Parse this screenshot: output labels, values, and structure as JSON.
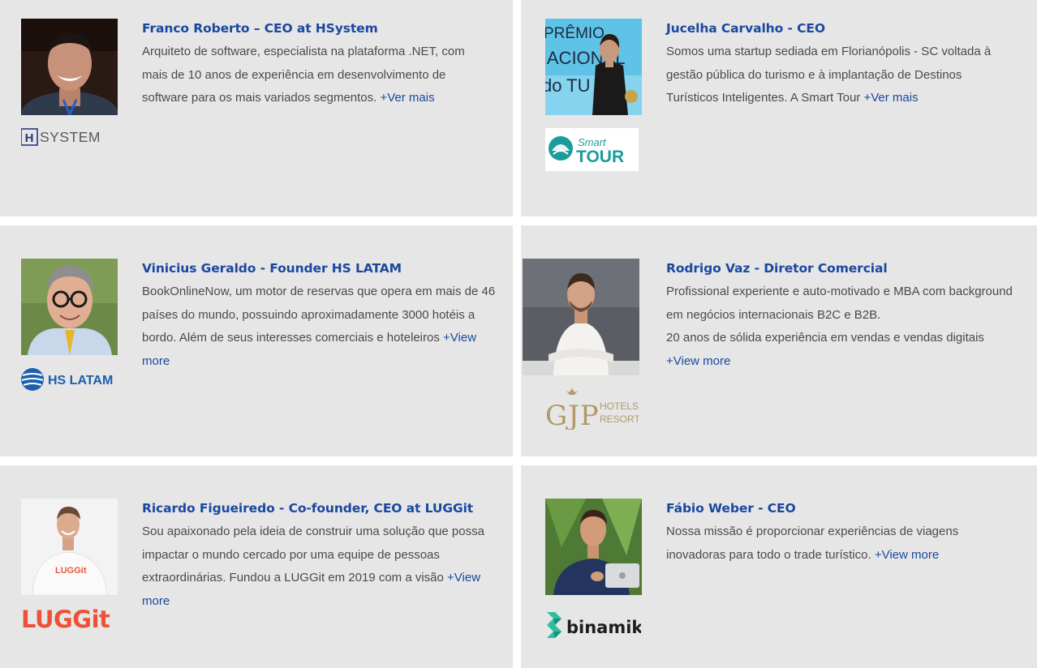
{
  "speakers": [
    {
      "name": "Franco Roberto – CEO at HSystem",
      "bio_lines": [
        "Arquiteto de software, especialista na plataforma .NET, com",
        "mais de 10 anos de experiência em desenvolvimento de",
        "software para os mais variados segmentos."
      ],
      "more_label": "+Ver mais",
      "logo_text": "SYSTEM",
      "logo_mark": "H"
    },
    {
      "name": "Jucelha Carvalho - CEO",
      "bio_lines": [
        "Somos uma startup sediada em Florianópolis - SC voltada à",
        "gestão pública do turismo e à implantação de Destinos",
        "Turísticos Inteligentes. A Smart Tour"
      ],
      "more_label": "+Ver mais",
      "photo_text": [
        "PRÊMIO",
        "NACIONAL",
        "do TU"
      ],
      "logo_text_top": "Smart",
      "logo_text_bottom": "TOUR"
    },
    {
      "name": "Vinicius Geraldo - Founder HS LATAM",
      "bio_lines": [
        "BookOnlineNow, um motor de reservas que opera em mais de 46",
        "países do mundo, possuindo aproximadamente 3000 hotéis a",
        "bordo. Além de seus interesses comerciais e hoteleiros",
        "more"
      ],
      "more_label": "+View",
      "logo_text": "HS LATAM"
    },
    {
      "name": "Rodrigo Vaz - Diretor Comercial",
      "bio_lines": [
        "Profissional experiente e auto-motivado e MBA com background",
        "em negócios internacionais B2C e B2B.",
        "20 anos de sólida experiência em vendas e vendas digitais"
      ],
      "more_label": "+View more",
      "logo_text": "GJP",
      "logo_sub": [
        "HOTELS &",
        "RESORTS"
      ]
    },
    {
      "name": "Ricardo Figueiredo - Co-founder, CEO at LUGGit",
      "bio_lines": [
        "Sou apaixonado pela ideia de construir uma solução que possa",
        "impactar o mundo cercado por uma equipe de pessoas",
        "extraordinárias. Fundou a LUGGit em 2019 com a visão",
        "more"
      ],
      "more_label": "+View",
      "photo_text": "LUGGit",
      "logo_text": "LUGGit"
    },
    {
      "name": "Fábio Weber - CEO",
      "bio_lines": [
        "Nossa missão é proporcionar experiências de viagens",
        "inovadoras para todo o trade turístico."
      ],
      "more_label": "+View more",
      "logo_text": "binamik"
    }
  ],
  "colors": {
    "card_bg": "#e6e6e6",
    "name": "#1a48a0",
    "bio": "#4a4a4a",
    "link": "#1a48a0"
  }
}
